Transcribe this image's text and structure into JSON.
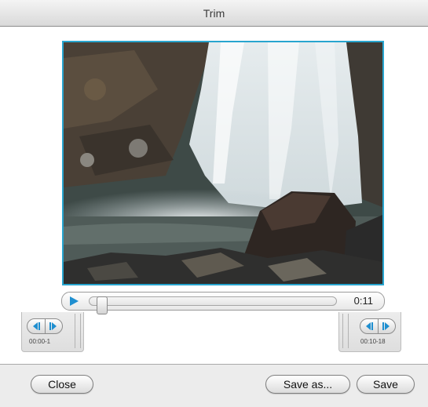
{
  "window": {
    "title": "Trim"
  },
  "player": {
    "time_label": "0:11",
    "playhead_fraction": 0.03,
    "trim_start_label": "00:00-1",
    "trim_end_label": "00:10-18"
  },
  "buttons": {
    "close": "Close",
    "save_as": "Save as...",
    "save": "Save"
  },
  "colors": {
    "accent": "#28a5cf",
    "play_icon": "#1f8fd0"
  },
  "icons": [
    "play-icon",
    "step-back-icon",
    "step-forward-icon"
  ]
}
